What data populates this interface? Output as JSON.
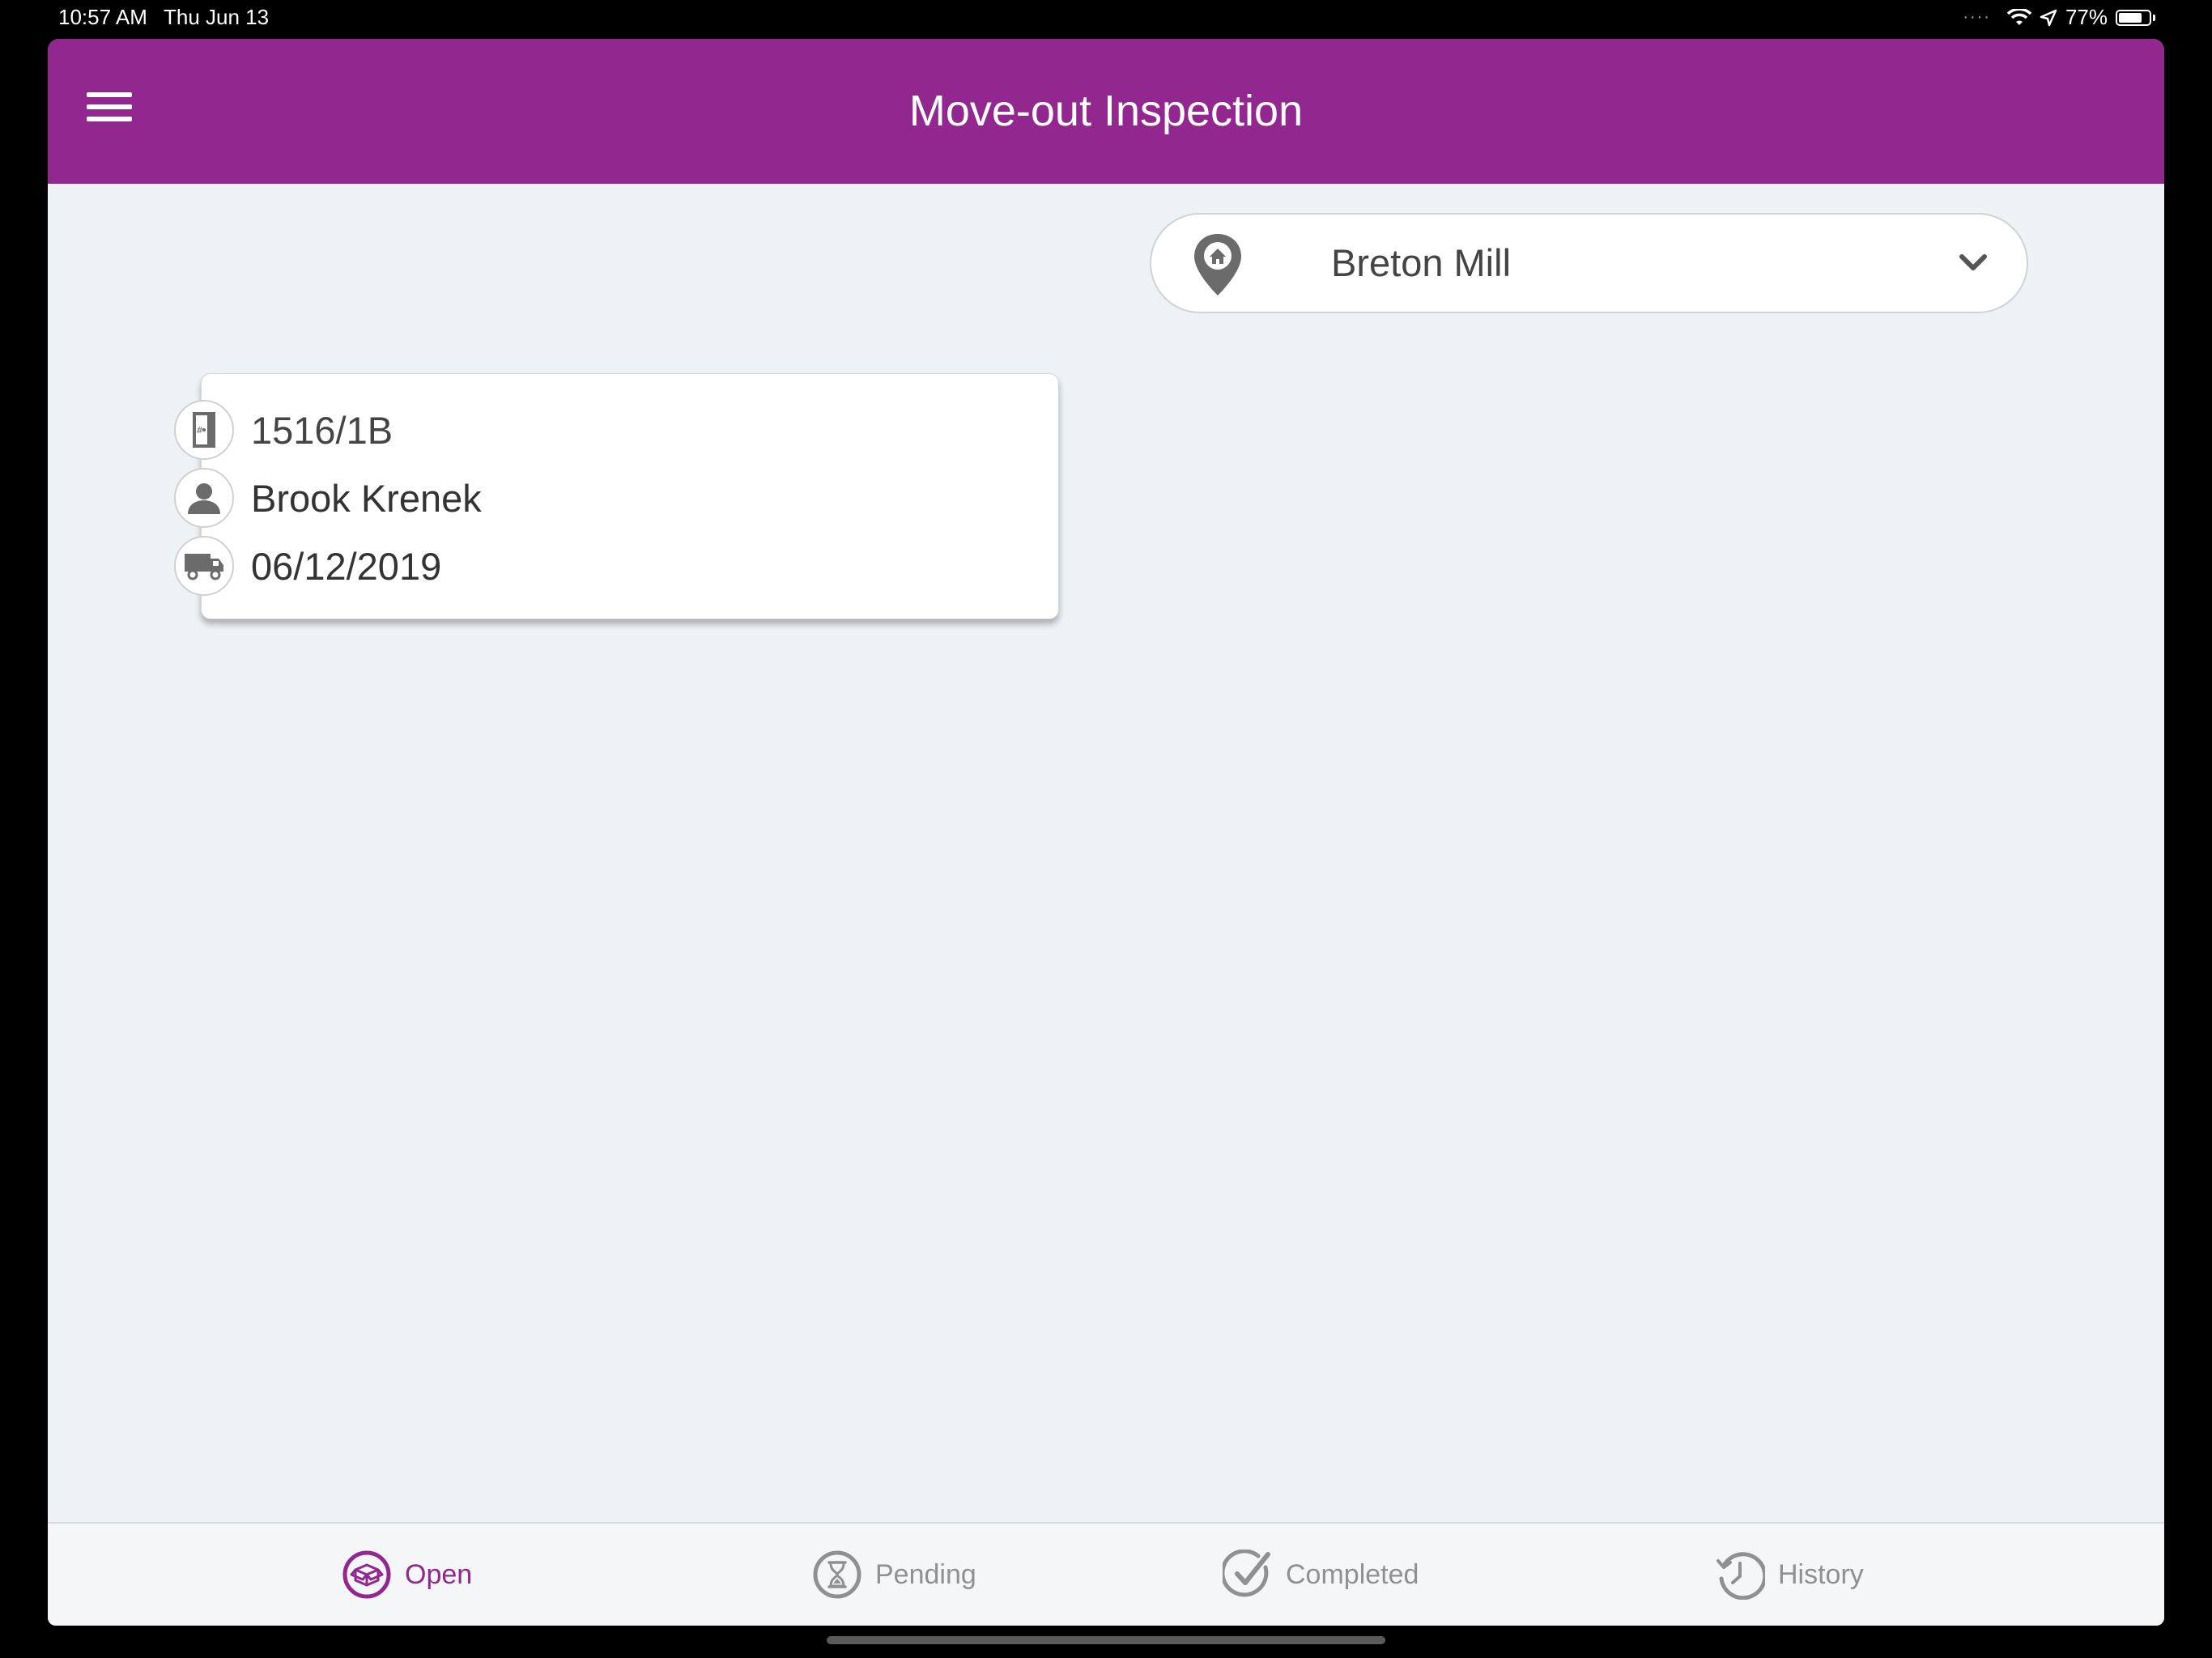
{
  "status_bar": {
    "time": "10:57 AM",
    "date": "Thu Jun 13",
    "battery": "77%",
    "battery_level": 0.77
  },
  "header": {
    "title": "Move-out Inspection",
    "menu_icon": "hamburger-menu-icon",
    "background_color": "#92278f"
  },
  "property_select": {
    "value": "Breton Mill",
    "icon": "home-location-pin-icon"
  },
  "inspections": [
    {
      "unit": "1516/1B",
      "resident": "Brook Krenek",
      "move_out_date": "06/12/2019",
      "icons": [
        "door-icon",
        "person-icon",
        "moving-truck-icon"
      ]
    }
  ],
  "tabs": [
    {
      "label": "Open",
      "icon": "open-box-icon",
      "active": true
    },
    {
      "label": "Pending",
      "icon": "hourglass-icon",
      "active": false
    },
    {
      "label": "Completed",
      "icon": "checkmark-icon",
      "active": false
    },
    {
      "label": "History",
      "icon": "history-clock-icon",
      "active": false
    }
  ],
  "colors": {
    "accent": "#92278f",
    "background": "#eef2f5",
    "inactive_tab": "#909090"
  }
}
